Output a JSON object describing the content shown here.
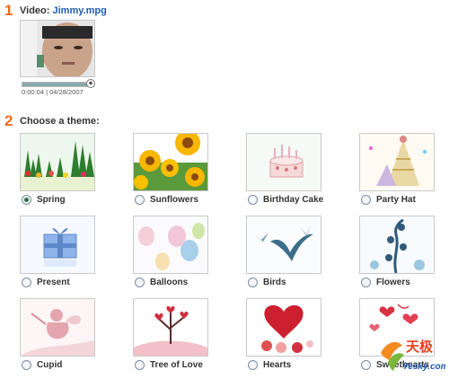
{
  "step1": {
    "number": "1",
    "label": "Video:",
    "filename": "Jimmy.mpg"
  },
  "video": {
    "timestamp": "0:00:04 | 04/28/2007",
    "progress": 0.95
  },
  "step2": {
    "number": "2",
    "label": "Choose a theme:"
  },
  "themes": [
    {
      "label": "Spring",
      "selected": true
    },
    {
      "label": "Sunflowers",
      "selected": false
    },
    {
      "label": "Birthday Cake",
      "selected": false
    },
    {
      "label": "Party Hat",
      "selected": false
    },
    {
      "label": "Present",
      "selected": false
    },
    {
      "label": "Balloons",
      "selected": false
    },
    {
      "label": "Birds",
      "selected": false
    },
    {
      "label": "Flowers",
      "selected": false
    },
    {
      "label": "Cupid",
      "selected": false
    },
    {
      "label": "Tree of Love",
      "selected": false
    },
    {
      "label": "Hearts",
      "selected": false
    },
    {
      "label": "Sweethearts",
      "selected": false
    }
  ],
  "watermark": {
    "brand": "天极",
    "site": "Yesky.com"
  },
  "colors": {
    "step_number": "#f26b1d",
    "link": "#1f5bb0"
  }
}
